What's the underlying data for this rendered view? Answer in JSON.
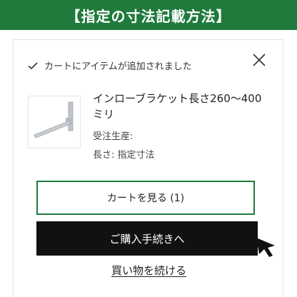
{
  "banner": {
    "title": "【指定の寸法記載方法】"
  },
  "notice": {
    "text": "カートにアイテムが追加されました"
  },
  "product": {
    "title": "インローブラケット長さ260〜400ミリ",
    "line1": "受注生産:",
    "line2": "長さ: 指定寸法"
  },
  "actions": {
    "view_cart": "カートを見る (1)",
    "checkout": "ご購入手続きへ",
    "continue": "買い物を続ける"
  },
  "colors": {
    "accent": "#1f7a3c",
    "checkout_bg": "#111111"
  },
  "icons": {
    "check": "check-icon",
    "close": "close-icon",
    "pointer": "hand-pointer-icon"
  }
}
